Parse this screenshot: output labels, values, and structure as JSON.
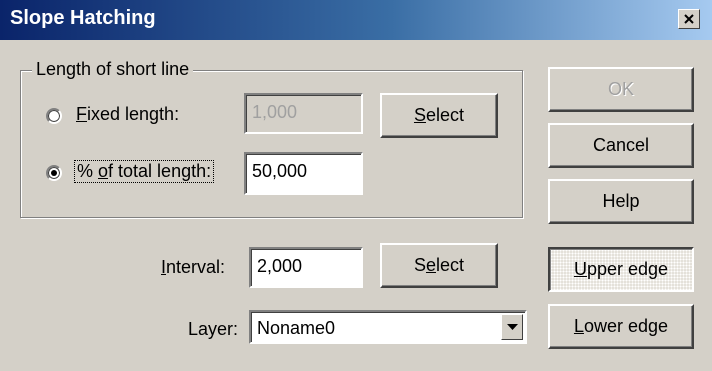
{
  "window": {
    "title": "Slope Hatching"
  },
  "group": {
    "legend": "Length of short line",
    "fixed_length": {
      "accel": "F",
      "label_rest": "ixed length:",
      "selected": false,
      "value": "1,000",
      "select_button": {
        "pre": "",
        "accel": "S",
        "post": "elect"
      }
    },
    "percent_length": {
      "pre": "% ",
      "accel": "o",
      "label_rest": "f total length:",
      "selected": true,
      "value": "50,000"
    }
  },
  "interval": {
    "accel": "I",
    "label_rest": "nterval:",
    "value": "2,000",
    "select_button": {
      "pre": "S",
      "accel": "e",
      "post": "lect"
    }
  },
  "layer": {
    "label": "Layer:",
    "value": "Noname0"
  },
  "buttons": {
    "ok": "OK",
    "cancel": "Cancel",
    "help": "Help",
    "upper_edge": {
      "accel": "U",
      "rest": "pper edge"
    },
    "lower_edge": {
      "accel": "L",
      "rest": "ower edge"
    }
  }
}
